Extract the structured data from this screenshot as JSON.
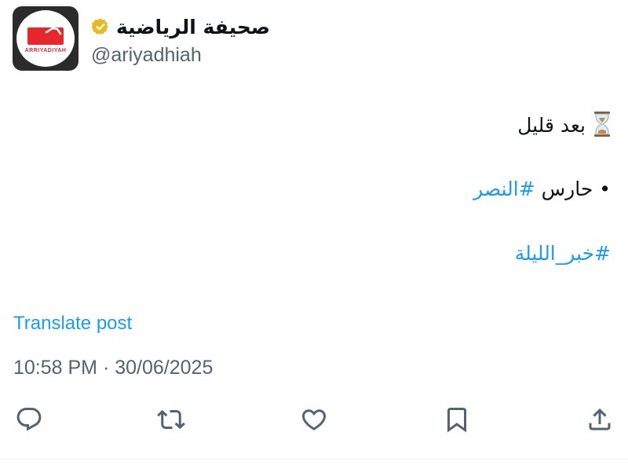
{
  "author": {
    "display_name": "صحيفة الرياضية",
    "handle": "@ariyadhiah",
    "verified": true,
    "avatar_text": "ARRIYADIYAH"
  },
  "post": {
    "line1_text": "بعد قليل",
    "line1_icon": "hourglass-icon",
    "line2_prefix": "• حارس ",
    "line2_hashtag": "#النصر",
    "line3_hashtag": "#خبر_الليلة"
  },
  "translate_label": "Translate post",
  "timestamp": "10:58 PM · 30/06/2025",
  "actions": {
    "reply": "reply-icon",
    "repost": "repost-icon",
    "like": "heart-icon",
    "bookmark": "bookmark-icon",
    "share": "share-icon"
  },
  "colors": {
    "link": "#1d9bf0",
    "secondary_text": "#536471",
    "primary_text": "#0f1419",
    "verified_badge": "#e8b923",
    "brand_red": "#e8262b"
  }
}
